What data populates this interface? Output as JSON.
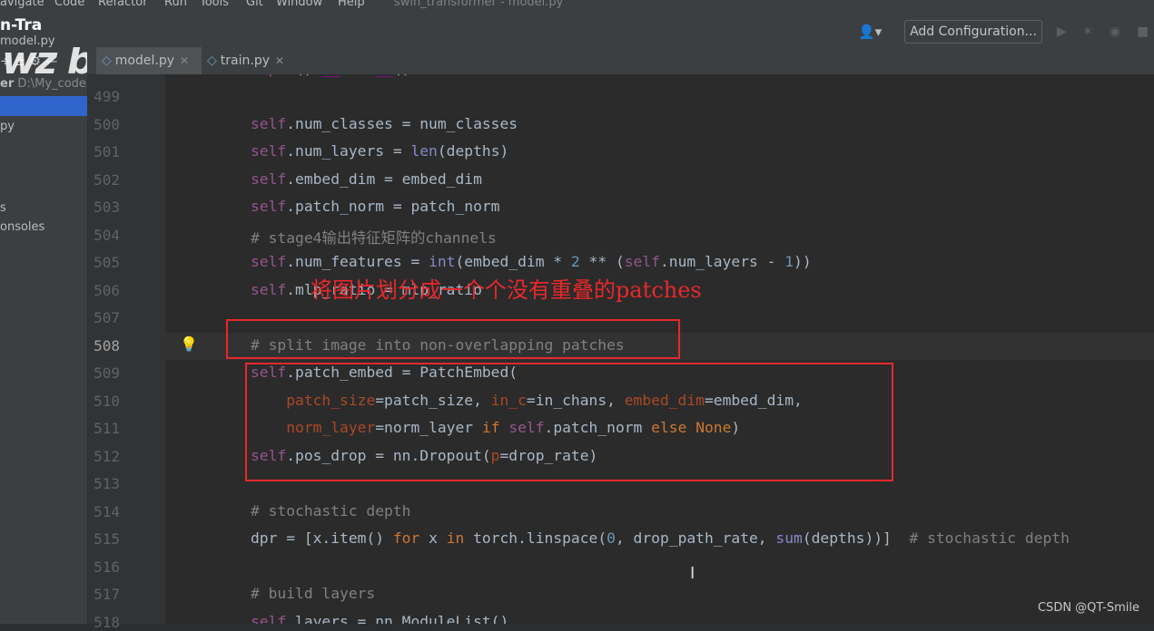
{
  "menubar": {
    "items": [
      "avigate",
      "Code",
      "Refactor",
      "Run",
      "Tools",
      "Git",
      "Window",
      "Help"
    ],
    "title": "swin_transformer - model.py"
  },
  "project": {
    "title": "n-Tra",
    "file": "model.py"
  },
  "watermark": "wz bilibili",
  "toolbar": {
    "user_icon": "user-icon",
    "add_config": "Add Configuration...",
    "icons": [
      "run-icon",
      "debug-icon",
      "coverage-icon",
      "stop-icon"
    ]
  },
  "sidebar": {
    "tool_icons": "÷  ±  ⚙  —",
    "header_label": "er",
    "header_path": "D:\\My_code",
    "rows": [
      "py",
      "s",
      "onsoles"
    ]
  },
  "tabs": [
    {
      "label": "model.py",
      "icon": "python-file-icon",
      "active": true
    },
    {
      "label": "train.py",
      "icon": "python-file-icon",
      "active": false
    }
  ],
  "editor": {
    "current_line": "508",
    "lines": [
      {
        "n": "499",
        "html": ""
      },
      {
        "n": "500",
        "html": "<span class=\"kw-self\">self</span>.num_classes = num_classes"
      },
      {
        "n": "501",
        "html": "<span class=\"kw-self\">self</span>.num_layers = <span class=\"fn\">len</span>(depths)"
      },
      {
        "n": "502",
        "html": "<span class=\"kw-self\">self</span>.embed_dim = embed_dim"
      },
      {
        "n": "503",
        "html": "<span class=\"kw-self\">self</span>.patch_norm = patch_norm"
      },
      {
        "n": "504",
        "html": "<span class=\"cm\"># stage4输出特征矩阵的channels</span>"
      },
      {
        "n": "505",
        "html": "<span class=\"kw-self\">self</span>.num_features = <span class=\"fn\">int</span>(embed_dim * <span class=\"num\">2</span> ** (<span class=\"kw-self\">self</span>.num_layers - <span class=\"num\">1</span>))"
      },
      {
        "n": "506",
        "html": "<span class=\"kw-self\">self</span>.mlp_ratio = mlp_ratio"
      },
      {
        "n": "507",
        "html": ""
      },
      {
        "n": "508",
        "html": "<span class=\"cm\"># split image into non-overlapping patches</span>"
      },
      {
        "n": "509",
        "html": "<span class=\"kw-self\">self</span>.patch_embed = PatchEmbed("
      },
      {
        "n": "510",
        "html": "    <span class=\"param\">patch_size</span>=patch_size, <span class=\"param\">in_c</span>=in_chans, <span class=\"param\">embed_dim</span>=embed_dim,"
      },
      {
        "n": "511",
        "html": "    <span class=\"param\">norm_layer</span>=norm_layer <span class=\"kw\">if</span> <span class=\"kw-self\">self</span>.patch_norm <span class=\"kw\">else</span> <span class=\"kw\">None</span>)"
      },
      {
        "n": "512",
        "html": "<span class=\"kw-self\">self</span>.pos_drop = nn.Dropout(<span class=\"param\">p</span>=drop_rate)"
      },
      {
        "n": "513",
        "html": ""
      },
      {
        "n": "514",
        "html": "<span class=\"cm\"># stochastic depth</span>"
      },
      {
        "n": "515",
        "html": "dpr = [x.item() <span class=\"kw\">for</span> x <span class=\"kw\">in</span> torch.linspace(<span class=\"num\">0</span>, drop_path_rate, <span class=\"fn\">sum</span>(depths))]  <span class=\"cm\"># stochastic depth</span>"
      },
      {
        "n": "516",
        "html": ""
      },
      {
        "n": "517",
        "html": "<span class=\"cm\"># build layers</span>"
      },
      {
        "n": "518",
        "html": "<span class=\"kw-self\">self</span>.layers = nn.ModuleList()"
      }
    ],
    "top_partial": "super().__init__()"
  },
  "annotation": "将图片划分成一个个没有重叠的patches",
  "credit": "CSDN @QT-Smile",
  "colors": {
    "annotation": "#e8282b",
    "keyword_self": "#94558d",
    "keyword": "#cc7832",
    "comment": "#808080"
  }
}
